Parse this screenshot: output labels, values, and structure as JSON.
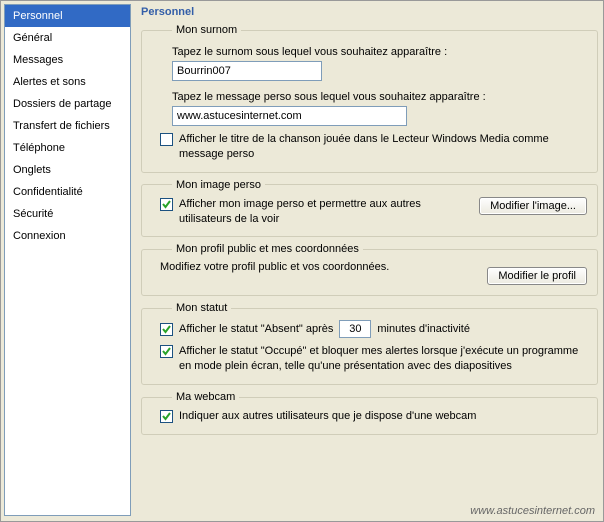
{
  "sidebar": {
    "items": [
      {
        "label": "Personnel"
      },
      {
        "label": "Général"
      },
      {
        "label": "Messages"
      },
      {
        "label": "Alertes et sons"
      },
      {
        "label": "Dossiers de partage"
      },
      {
        "label": "Transfert de fichiers"
      },
      {
        "label": "Téléphone"
      },
      {
        "label": "Onglets"
      },
      {
        "label": "Confidentialité"
      },
      {
        "label": "Sécurité"
      },
      {
        "label": "Connexion"
      }
    ],
    "selected_index": 0
  },
  "page": {
    "title": "Personnel"
  },
  "surnom": {
    "legend": "Mon surnom",
    "label1": "Tapez le surnom sous lequel vous souhaitez apparaître :",
    "nickname_value": "Bourrin007",
    "label2": "Tapez le message perso sous lequel vous souhaitez apparaître :",
    "msg_value": "www.astucesinternet.com",
    "show_song_checked": false,
    "show_song_label": "Afficher le titre de la chanson jouée dans le Lecteur Windows Media comme message perso"
  },
  "image_perso": {
    "legend": "Mon image perso",
    "show_image_checked": true,
    "show_image_label": "Afficher mon image perso et permettre aux autres utilisateurs de la voir",
    "modify_btn": "Modifier l'image..."
  },
  "profil": {
    "legend": "Mon profil public et mes coordonnées",
    "text": "Modifiez votre profil public et vos coordonnées.",
    "modify_btn": "Modifier le profil"
  },
  "statut": {
    "legend": "Mon statut",
    "absent_checked": true,
    "absent_label_before": "Afficher le statut \"Absent\" après",
    "absent_minutes": "30",
    "absent_label_after": "minutes d'inactivité",
    "occupe_checked": true,
    "occupe_label": "Afficher le statut \"Occupé\" et bloquer mes alertes lorsque j'exécute un programme en mode plein écran, telle qu'une présentation avec des diapositives"
  },
  "webcam": {
    "legend": "Ma webcam",
    "have_cam_checked": true,
    "have_cam_label": "Indiquer aux autres utilisateurs que je dispose d'une webcam"
  },
  "footer": "www.astucesinternet.com"
}
